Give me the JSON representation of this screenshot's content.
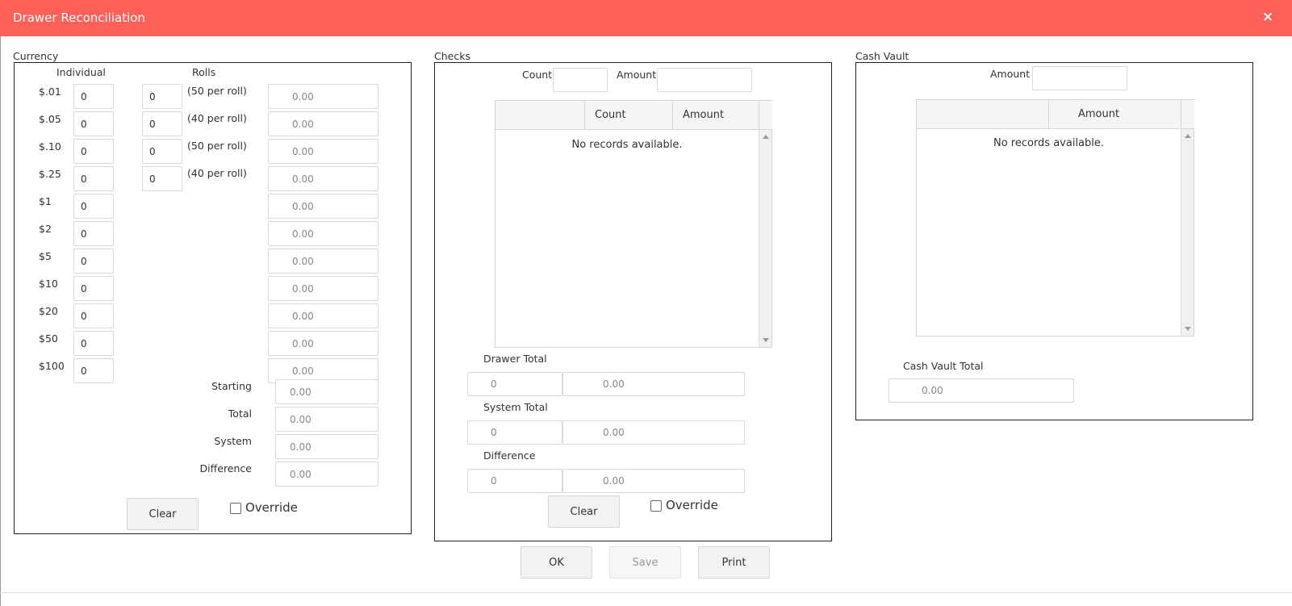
{
  "window": {
    "title": "Drawer Reconciliation",
    "close_icon": "×"
  },
  "currency": {
    "label": "Currency",
    "col_individual": "Individual",
    "col_rolls": "Rolls",
    "rows": [
      {
        "denom": "$.01",
        "individual": "0",
        "rolls": "0",
        "roll_note": "(50 per roll)",
        "amount": "0.00"
      },
      {
        "denom": "$.05",
        "individual": "0",
        "rolls": "0",
        "roll_note": "(40 per roll)",
        "amount": "0.00"
      },
      {
        "denom": "$.10",
        "individual": "0",
        "rolls": "0",
        "roll_note": "(50 per roll)",
        "amount": "0.00"
      },
      {
        "denom": "$.25",
        "individual": "0",
        "rolls": "0",
        "roll_note": "(40 per roll)",
        "amount": "0.00"
      },
      {
        "denom": "$1",
        "individual": "0",
        "amount": "0.00"
      },
      {
        "denom": "$2",
        "individual": "0",
        "amount": "0.00"
      },
      {
        "denom": "$5",
        "individual": "0",
        "amount": "0.00"
      },
      {
        "denom": "$10",
        "individual": "0",
        "amount": "0.00"
      },
      {
        "denom": "$20",
        "individual": "0",
        "amount": "0.00"
      },
      {
        "denom": "$50",
        "individual": "0",
        "amount": "0.00"
      },
      {
        "denom": "$100",
        "individual": "0",
        "amount": "0.00"
      }
    ],
    "summary": [
      {
        "label": "Starting",
        "value": "0.00"
      },
      {
        "label": "Total",
        "value": "0.00"
      },
      {
        "label": "System",
        "value": "0.00"
      },
      {
        "label": "Difference",
        "value": "0.00"
      }
    ],
    "clear_label": "Clear",
    "override_label": "Override"
  },
  "checks": {
    "label": "Checks",
    "count_label": "Count",
    "count_value": "",
    "amount_label": "Amount",
    "amount_value": "",
    "grid": {
      "columns": [
        "",
        "Count",
        "Amount"
      ],
      "empty_text": "No records available."
    },
    "totals": [
      {
        "label": "Drawer Total",
        "count": "0",
        "amount": "0.00"
      },
      {
        "label": "System Total",
        "count": "0",
        "amount": "0.00"
      },
      {
        "label": "Difference",
        "count": "0",
        "amount": "0.00"
      }
    ],
    "clear_label": "Clear",
    "override_label": "Override"
  },
  "cash_vault": {
    "label": "Cash Vault",
    "amount_label": "Amount",
    "amount_value": "",
    "grid": {
      "columns": [
        "",
        "Amount"
      ],
      "empty_text": "No records available."
    },
    "total_label": "Cash Vault Total",
    "total_value": "0.00"
  },
  "footer": {
    "ok_label": "OK",
    "save_label": "Save",
    "print_label": "Print"
  }
}
